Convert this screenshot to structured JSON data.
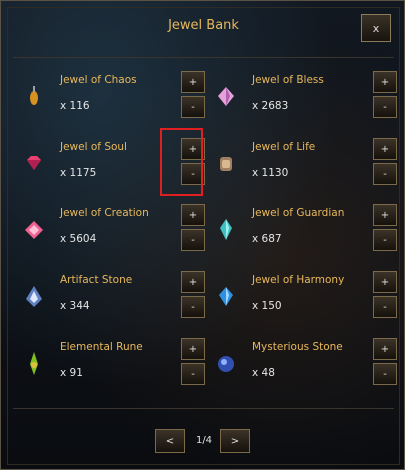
{
  "window": {
    "title": "Jewel Bank",
    "close_label": "x"
  },
  "buttons": {
    "plus": "+",
    "minus": "-"
  },
  "items": [
    {
      "name": "Jewel of Chaos",
      "count": "x 116",
      "icon": "jewel-of-chaos-icon"
    },
    {
      "name": "Jewel of Bless",
      "count": "x 2683",
      "icon": "jewel-of-bless-icon"
    },
    {
      "name": "Jewel of Soul",
      "count": "x 1175",
      "icon": "jewel-of-soul-icon"
    },
    {
      "name": "Jewel of Life",
      "count": "x 1130",
      "icon": "jewel-of-life-icon"
    },
    {
      "name": "Jewel of Creation",
      "count": "x 5604",
      "icon": "jewel-of-creation-icon"
    },
    {
      "name": "Jewel of Guardian",
      "count": "x 687",
      "icon": "jewel-of-guardian-icon"
    },
    {
      "name": "Artifact Stone",
      "count": "x 344",
      "icon": "artifact-stone-icon"
    },
    {
      "name": "Jewel of Harmony",
      "count": "x 150",
      "icon": "jewel-of-harmony-icon"
    },
    {
      "name": "Elemental Rune",
      "count": "x 91",
      "icon": "elemental-rune-icon"
    },
    {
      "name": "Mysterious Stone",
      "count": "x 48",
      "icon": "mysterious-stone-icon"
    }
  ],
  "pagination": {
    "prev_label": "<",
    "page": "1/4",
    "next_label": ">"
  },
  "colors": {
    "title": "#e8b85c",
    "highlight": "#e02020"
  }
}
